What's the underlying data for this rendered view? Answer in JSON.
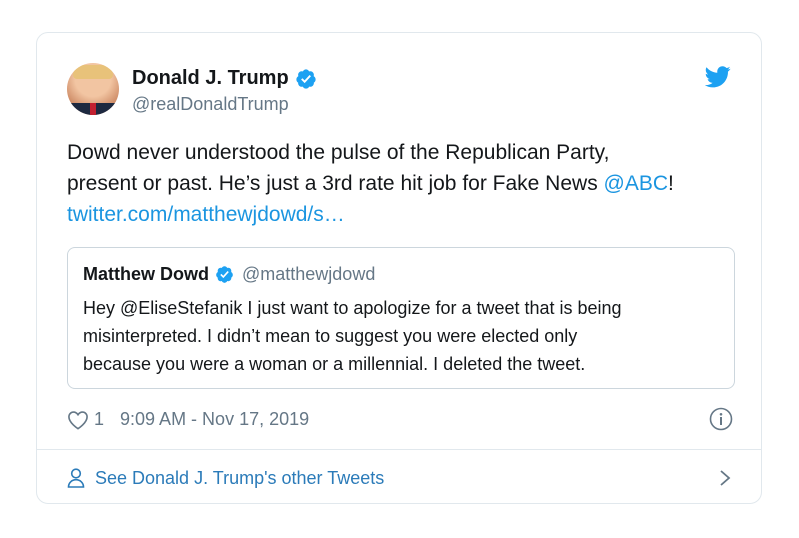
{
  "author": {
    "display_name": "Donald J. Trump",
    "handle": "@realDonaldTrump"
  },
  "tweet": {
    "lines": [
      {
        "text": "Dowd never understood the pulse of the Republican Party,"
      },
      {
        "text": "present or past. He’s just a 3rd rate hit job for Fake News ",
        "mention": "@ABC",
        "suffix": "!"
      },
      {
        "link": "twitter.com/matthewjdowd/s…"
      }
    ]
  },
  "quoted": {
    "display_name": "Matthew Dowd",
    "handle": "@matthewjdowd",
    "lines": [
      "Hey @EliseStefanik I just want to apologize for a tweet that is being",
      "misinterpreted. I didn’t mean to suggest you were elected only",
      "because you were a woman or a millennial.  I deleted the tweet."
    ]
  },
  "meta": {
    "like_count": "1",
    "timestamp": "9:09 AM - Nov 17, 2019"
  },
  "footer": {
    "label": "See Donald J. Trump's other Tweets"
  },
  "icons": {
    "brand": "twitter-bird-icon",
    "verified": "verified-badge-icon",
    "like": "heart-icon",
    "info": "info-icon",
    "profile": "user-icon",
    "chevron": "chevron-right-icon"
  },
  "colors": {
    "link": "#1b95e0",
    "verified": "#1da1f2",
    "secondary_text": "#657786",
    "border": "#e1e8ed"
  }
}
